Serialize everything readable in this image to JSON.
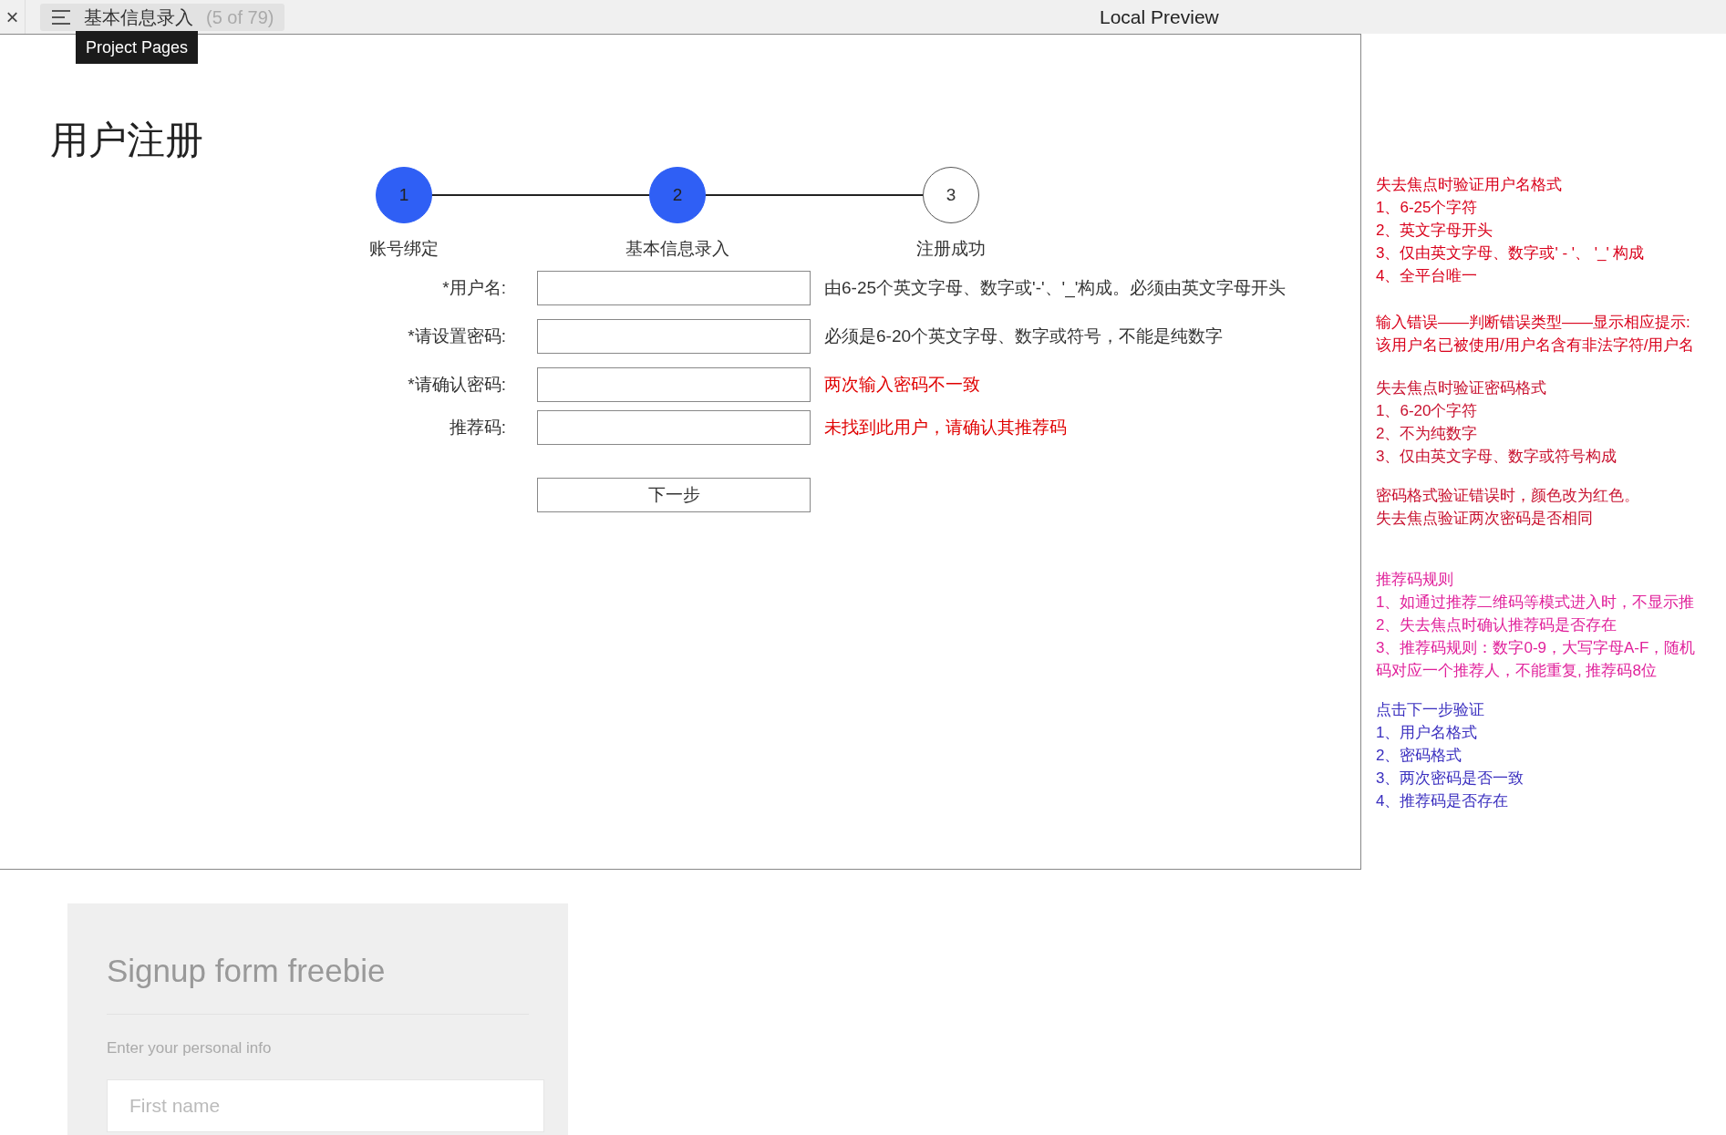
{
  "toolbar": {
    "close": "×",
    "page_title": "基本信息录入",
    "page_count": "(5 of 79)",
    "center_title": "Local Preview",
    "tooltip": "Project Pages"
  },
  "page": {
    "title": "用户注册",
    "steps": [
      {
        "number": "1",
        "label": "账号绑定",
        "done": true
      },
      {
        "number": "2",
        "label": "基本信息录入",
        "done": true
      },
      {
        "number": "3",
        "label": "注册成功",
        "done": false
      }
    ],
    "fields": [
      {
        "label": "*用户名:",
        "hint": "由6-25个英文字母、数字或'-'、'_'构成。必须由英文字母开头",
        "error": false
      },
      {
        "label": "*请设置密码:",
        "hint": "必须是6-20个英文字母、数字或符号，不能是纯数字",
        "error": false
      },
      {
        "label": "*请确认密码:",
        "hint": "两次输入密码不一致",
        "error": true
      },
      {
        "label": "推荐码:",
        "hint": "未找到此用户，请确认其推荐码",
        "error": true
      }
    ],
    "next_button": "下一步"
  },
  "notes": [
    {
      "color": "#d9001b",
      "lines": [
        "失去焦点时验证用户名格式",
        "1、6-25个字符",
        "2、英文字母开头",
        "3、仅由英文字母、数字或' - '、 '_' 构成",
        "4、全平台唯一"
      ]
    },
    {
      "color": "#d9001b",
      "lines": [
        "输入错误——判断错误类型——显示相应提示:",
        "该用户名已被使用/用户名含有非法字符/用户名"
      ]
    },
    {
      "color": "#c8102e",
      "lines": [
        "失去焦点时验证密码格式",
        "1、6-20个字符",
        "2、不为纯数字",
        "3、仅由英文字母、数字或符号构成"
      ]
    },
    {
      "color": "#c8102e",
      "lines": [
        "密码格式验证错误时，颜色改为红色。",
        "失去焦点验证两次密码是否相同"
      ]
    },
    {
      "color": "#e0209a",
      "lines": [
        "推荐码规则",
        "1、如通过推荐二维码等模式进入时，不显示推",
        "2、失去焦点时确认推荐码是否存在",
        "3、推荐码规则：数字0-9，大写字母A-F，随机",
        "码对应一个推荐人，不能重复, 推荐码8位"
      ]
    },
    {
      "color": "#3a2fbf",
      "lines": [
        "点击下一步验证",
        "1、用户名格式",
        "2、密码格式",
        "3、两次密码是否一致",
        "4、推荐码是否存在"
      ]
    }
  ],
  "signup_card": {
    "title": "Signup form freebie",
    "subtitle": "Enter your personal info",
    "first_name_placeholder": "First name"
  }
}
